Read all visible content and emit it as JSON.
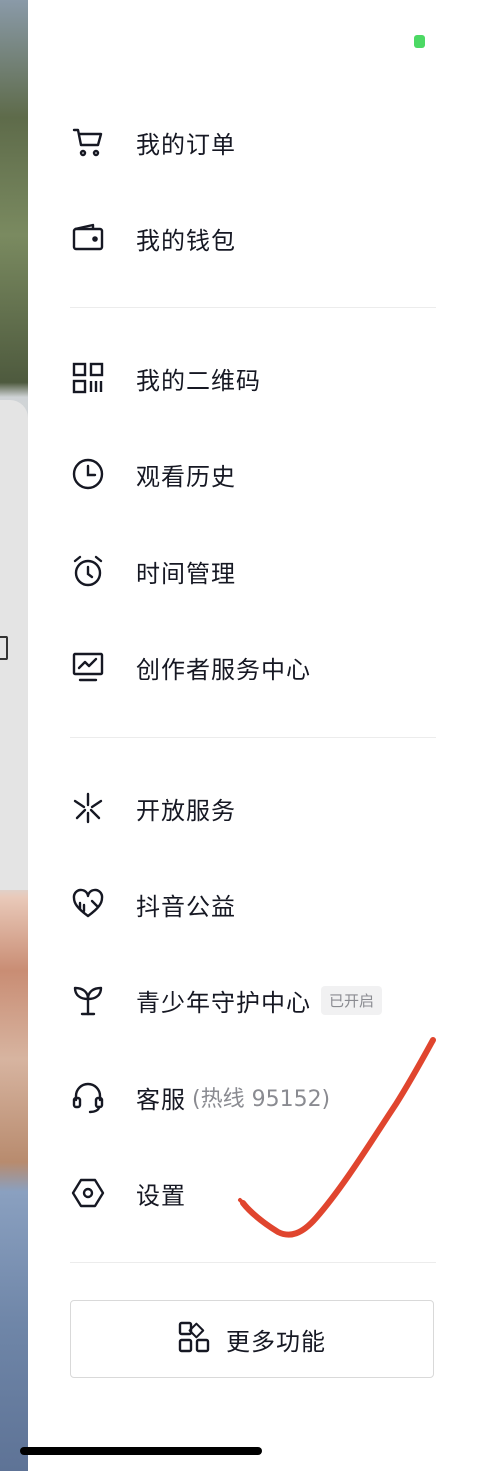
{
  "drawer": {
    "section1": [
      {
        "label": "我的订单",
        "icon": "cart-icon"
      },
      {
        "label": "我的钱包",
        "icon": "wallet-icon"
      }
    ],
    "section2": [
      {
        "label": "我的二维码",
        "icon": "qrcode-icon"
      },
      {
        "label": "观看历史",
        "icon": "clock-icon"
      },
      {
        "label": "时间管理",
        "icon": "alarm-icon"
      },
      {
        "label": "创作者服务中心",
        "icon": "monitor-chart-icon"
      }
    ],
    "section3": [
      {
        "label": "开放服务",
        "icon": "asterisk-icon"
      },
      {
        "label": "抖音公益",
        "icon": "heart-icon"
      },
      {
        "label": "青少年守护中心",
        "icon": "sprout-icon",
        "badge": "已开启"
      },
      {
        "label": "客服",
        "icon": "headset-icon",
        "extra": "(热线 95152)"
      },
      {
        "label": "设置",
        "icon": "settings-hexagon-icon"
      }
    ],
    "more_button": {
      "label": "更多功能",
      "icon": "grid-shapes-icon"
    }
  },
  "colors": {
    "text": "#161823",
    "muted": "#8a8b91",
    "annotation": "#e0452e",
    "status": "#4cd964"
  }
}
